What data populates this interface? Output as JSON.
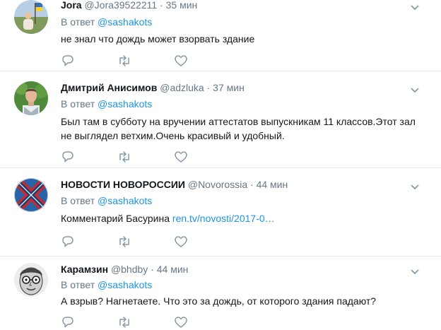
{
  "tweets": [
    {
      "name": "Jora",
      "handle": "@Jora39522211",
      "dot": "·",
      "time": "35 мин",
      "reply_prefix": "В ответ",
      "reply_to": "@sashakots",
      "text": "не знал что дождь может взорвать здание",
      "avatar": "outdoor-photo-avatar"
    },
    {
      "name": "Дмитрий Анисимов",
      "handle": "@adzluka",
      "dot": "·",
      "time": "37 мин",
      "reply_prefix": "В ответ",
      "reply_to": "@sashakots",
      "text": "Был там в субботу на вручении аттестатов выпускникам 11 классов.Этот зал не выглядел ветхим.Очень красивый и удобный.",
      "avatar": "man-portrait-avatar"
    },
    {
      "name": "НОВОСТИ НОВОРОССИИ",
      "handle": "@Novorossia",
      "dot": "·",
      "time": "44 мин",
      "reply_prefix": "В ответ",
      "reply_to": "@sashakots",
      "text": "Комментарий Басурина",
      "link": "ren.tv/novosti/2017-0…",
      "avatar": "flag-avatar"
    },
    {
      "name": "Карамзин",
      "handle": "@bhdby",
      "dot": "·",
      "time": "44 мин",
      "reply_prefix": "В ответ",
      "reply_to": "@sashakots",
      "text": "А взрыв? Нагнетаете. Что это за дождь, от которого здания падают?",
      "avatar": "sketch-face-avatar"
    }
  ],
  "colors": {
    "accent": "#1b95e0",
    "secondary_text": "#657786",
    "border": "#e6ecf0",
    "icon": "#8899a6"
  },
  "icons": {
    "reply": "reply-icon",
    "retweet": "retweet-icon",
    "like": "heart-icon",
    "caret": "chevron-down-icon"
  }
}
